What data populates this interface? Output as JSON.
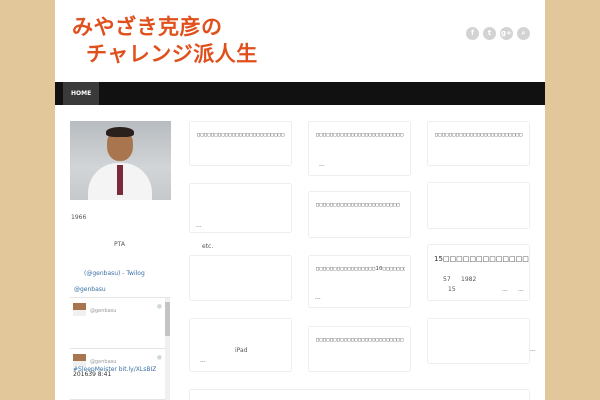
{
  "header": {
    "title_line1": "みやざき克彦の",
    "title_line2": "チャレンジ派人生",
    "social": [
      {
        "name": "facebook-icon",
        "glyph": "f"
      },
      {
        "name": "twitter-icon",
        "glyph": "t"
      },
      {
        "name": "google-plus-icon",
        "glyph": "g+"
      },
      {
        "name": "search-icon",
        "glyph": "⌕"
      }
    ]
  },
  "nav": {
    "home_label": "HOME"
  },
  "sidebar": {
    "year": "1966",
    "pta": "PTA",
    "twilog": "(@genbasu) - Twilog",
    "handle_link": "@genbasu",
    "tweets": [
      {
        "handle": "@genbasu",
        "text": ""
      },
      {
        "handle": "@genbasu",
        "text": "201639 8:41"
      }
    ],
    "hashtag": "#SleepMeister bit.ly/XLsBIZ"
  },
  "main": {
    "etc": "etc.",
    "col1": [
      {
        "title": "□□□□□□□□□□□□□□□□□□□□□□□□□",
        "note": ""
      },
      {
        "title": "",
        "note": "..."
      },
      {
        "title": "",
        "note": ""
      },
      {
        "title": "",
        "note": "iPad",
        "note2": "..."
      }
    ],
    "col2": [
      {
        "title": "□□□□□□□□□□□□□□□□□□□□□□□□□",
        "note": "..."
      },
      {
        "title": "□□□□□□□□□□□□□□□□□□□□□□□□",
        "note": ""
      },
      {
        "title": "□□□□□□□□□□□□□□□□□10□□□□□□□",
        "note": "..."
      },
      {
        "title": "□□□□□□□□□□□□□□□□□□□□□□□□□",
        "note": ""
      }
    ],
    "col3": [
      {
        "title": "□□□□□□□□□□□□□□□□□□□□□□□□□",
        "note": ""
      },
      {
        "title": "",
        "note": ""
      },
      {
        "title": "15□□□□□□□□□□□□□□□□□□",
        "l1a": "57",
        "l1b": "1982",
        "l2a": "15",
        "l2b": "...",
        "l2c": "..."
      },
      {
        "title": "",
        "note": "..."
      }
    ]
  }
}
